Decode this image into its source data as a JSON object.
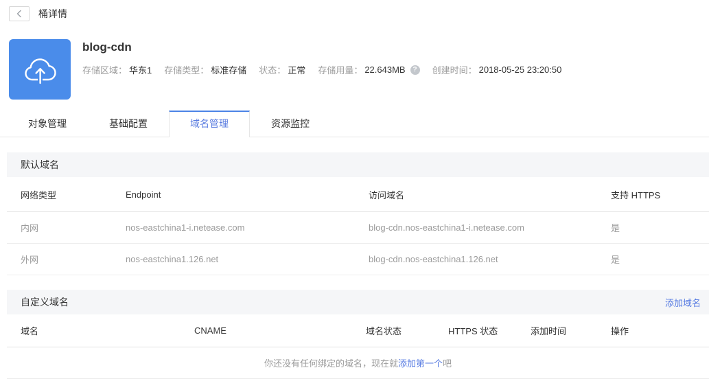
{
  "topbar": {
    "title": "桶详情"
  },
  "bucket": {
    "name": "blog-cdn",
    "meta": [
      {
        "label": "存储区域：",
        "value": "华东1"
      },
      {
        "label": "存储类型：",
        "value": "标准存储"
      },
      {
        "label": "状态：",
        "value": "正常"
      },
      {
        "label": "存储用量：",
        "value": "22.643MB"
      },
      {
        "label": "创建时间：",
        "value": "2018-05-25 23:20:50"
      }
    ]
  },
  "tabs": [
    {
      "label": "对象管理",
      "active": false
    },
    {
      "label": "基础配置",
      "active": false
    },
    {
      "label": "域名管理",
      "active": true
    },
    {
      "label": "资源监控",
      "active": false
    }
  ],
  "default_domains": {
    "section_title": "默认域名",
    "columns": [
      "网络类型",
      "Endpoint",
      "访问域名",
      "支持 HTTPS"
    ],
    "rows": [
      {
        "network_type": "内网",
        "endpoint": "nos-eastchina1-i.netease.com",
        "access_domain": "blog-cdn.nos-eastchina1-i.netease.com",
        "https": "是"
      },
      {
        "network_type": "外网",
        "endpoint": "nos-eastchina1.126.net",
        "access_domain": "blog-cdn.nos-eastchina1.126.net",
        "https": "是"
      }
    ]
  },
  "custom_domains": {
    "section_title": "自定义域名",
    "add_link": "添加域名",
    "columns": [
      "域名",
      "CNAME",
      "域名状态",
      "HTTPS 状态",
      "添加时间",
      "操作"
    ],
    "empty": {
      "prefix": "你还没有任何绑定的域名，现在就",
      "link": "添加第一个",
      "suffix": "吧"
    }
  },
  "icons": {
    "help": "?"
  },
  "colors": {
    "accent": "#587ce2",
    "tab_active_border": "#4c84e6",
    "icon_bg": "#4a8cea"
  }
}
